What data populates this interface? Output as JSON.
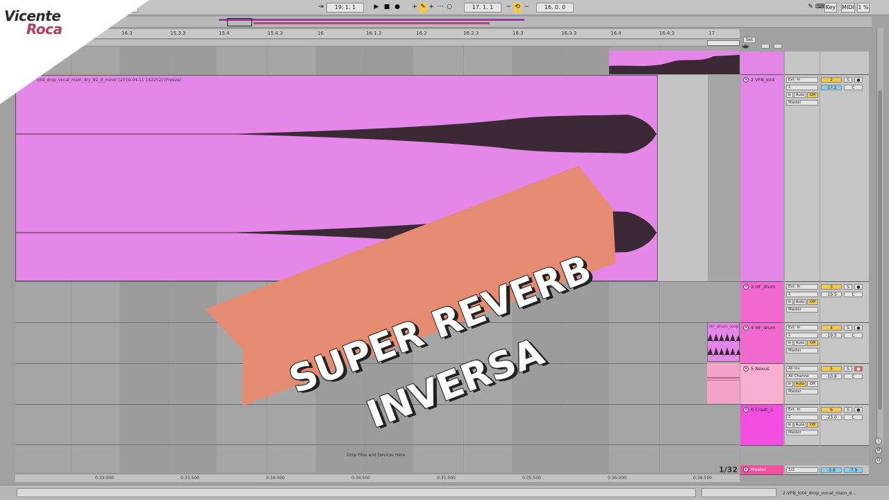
{
  "brand": {
    "line1": "Vicente",
    "line2": "Roca"
  },
  "banner": {
    "line1": "SUPER REVERB",
    "line2": "INVERSA"
  },
  "transport": {
    "arrangement_position": "19.  1.  1",
    "loop_start": "17.  1.  1",
    "loop_length": "16.  0.  0",
    "key_label": "Key",
    "midi_label": "MIDI",
    "cpu": "1 %"
  },
  "ruler": {
    "bar_labels": [
      "16.3",
      "15.3.3",
      "15.4",
      "15.4.3",
      "16",
      "16.1.3",
      "16.2",
      "16.2.3",
      "16.3",
      "16.3.3",
      "16.4",
      "16.4.3",
      "17"
    ]
  },
  "time_labels": [
    "0:33:000",
    "0:33:500",
    "0:34:000",
    "0:34:500",
    "0:35:000",
    "0:35:500",
    "0:36:000",
    "0:36:500"
  ],
  "clips": {
    "main_title": "kit4_drop_vocal_main_dry_82_d_minor [2019-04-11 142252] (Freeze)",
    "hf_label": "HF_drum_loop"
  },
  "drop_area": "Drop Files and Devices Here",
  "page_indicator": "1/32",
  "set_label": "Set",
  "tracks": [
    {
      "name": "2 VFB_kit4",
      "input": "Ext. In",
      "channel": "1",
      "in": "In",
      "auto": "Auto",
      "off": "Off",
      "output": "Master",
      "number": "2",
      "s": "S",
      "volume": "-17.2",
      "pan": "C",
      "color": "#e487e8"
    },
    {
      "name": "3 HF_drum",
      "input": "Ext. In",
      "channel": "1",
      "in": "In",
      "auto": "Auto",
      "off": "Off",
      "output": "Master",
      "number": "3",
      "s": "S",
      "volume": "-19.5",
      "pan": "C",
      "color": "#f06ad0"
    },
    {
      "name": "4 HF_drum",
      "input": "Ext. In",
      "channel": "1",
      "in": "In",
      "auto": "Auto",
      "off": "Off",
      "output": "Master",
      "number": "4",
      "s": "S",
      "volume": "-19.5",
      "pan": "C",
      "color": "#f06ad0"
    },
    {
      "name": "5 Nexus",
      "input": "All Ins",
      "channel": "All Channe",
      "in": "In",
      "auto": "Auto",
      "off": "Off",
      "output": "Master",
      "number": "5",
      "s": "S",
      "volume": "-10.8",
      "pan": "C",
      "color": "#f7aed0"
    },
    {
      "name": "6 Crash_1",
      "input": "Ext. In",
      "channel": "1",
      "in": "In",
      "auto": "Auto",
      "off": "Off",
      "output": "Master",
      "number": "6",
      "s": "S",
      "volume": "-23.0",
      "pan": "C",
      "color": "#f24fe0"
    }
  ],
  "master": {
    "name": "Master",
    "output": "1/2",
    "volume": "-3.8",
    "peak": "-7.9"
  },
  "status": {
    "text": "2-VFB_kit4_drop_vocal_main_d..."
  }
}
